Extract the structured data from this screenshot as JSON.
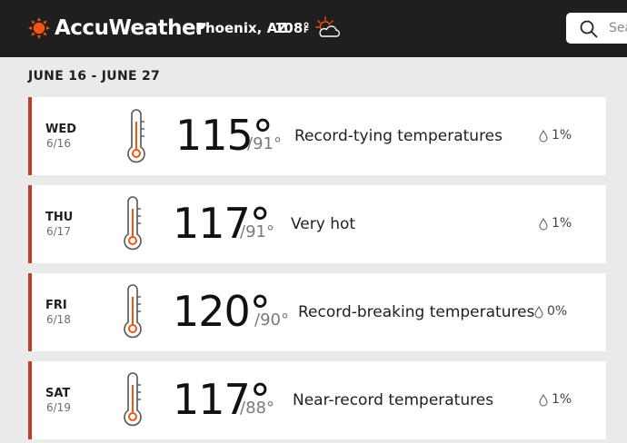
{
  "header": {
    "brand": "AccuWeather",
    "location": "Phoenix, AZ",
    "current_temp": "108°",
    "current_unit": "F",
    "current_icon": "partly-sunny-icon",
    "search_placeholder": "Search"
  },
  "forecast": {
    "range_label": "JUNE 16 - JUNE 27",
    "days": [
      {
        "dow": "WED",
        "date": "6/16",
        "hi": "115°",
        "lo": "/91°",
        "phrase": "Record-tying temperatures",
        "precip": "1%"
      },
      {
        "dow": "THU",
        "date": "6/17",
        "hi": "117°",
        "lo": "/91°",
        "phrase": "Very hot",
        "precip": "1%"
      },
      {
        "dow": "FRI",
        "date": "6/18",
        "hi": "120°",
        "lo": "/90°",
        "phrase": "Record-breaking temperatures",
        "precip": "0%"
      },
      {
        "dow": "SAT",
        "date": "6/19",
        "hi": "117°",
        "lo": "/88°",
        "phrase": "Near-record temperatures",
        "precip": "1%"
      }
    ]
  },
  "colors": {
    "header_bg": "#1f1f1f",
    "accent_orange": "#f05514",
    "card_border": "#c43b2b",
    "page_bg": "#eaeaea"
  }
}
